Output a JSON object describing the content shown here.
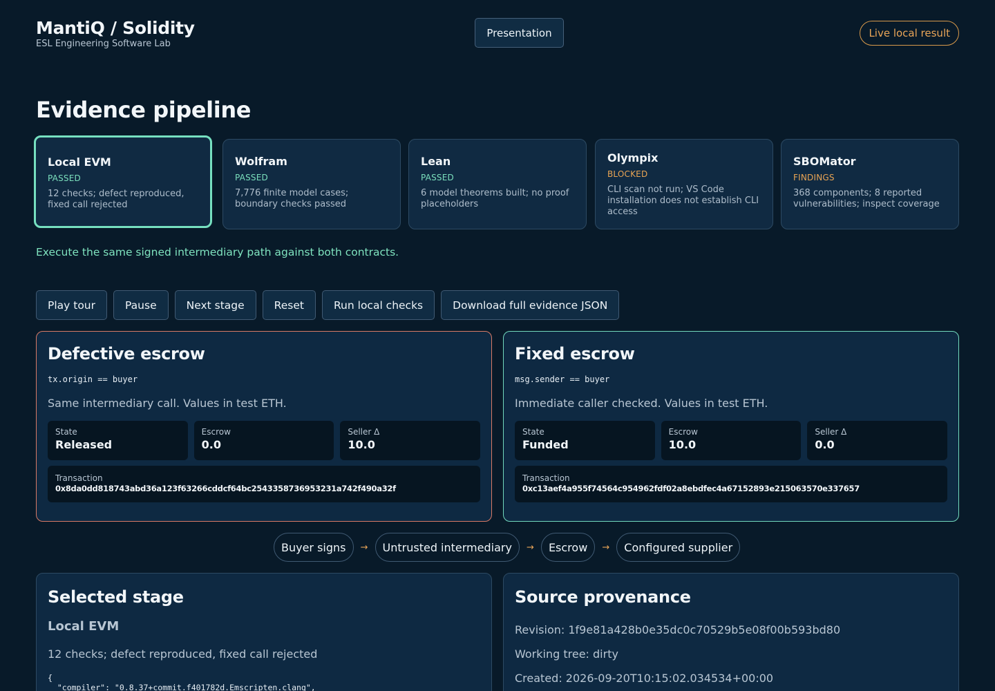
{
  "header": {
    "title": "MantiQ / Solidity",
    "subtitle": "ESL Engineering Software Lab",
    "presentation_label": "Presentation",
    "live_badge": "Live local result"
  },
  "pipeline": {
    "title": "Evidence pipeline",
    "stages": [
      {
        "name": "Local EVM",
        "status": "PASSED",
        "description": "12 checks; defect reproduced, fixed call rejected",
        "status_color": "#7be0bd"
      },
      {
        "name": "Wolfram",
        "status": "PASSED",
        "description": "7,776 finite model cases; boundary checks passed",
        "status_color": "#7be0bd"
      },
      {
        "name": "Lean",
        "status": "PASSED",
        "description": "6 model theorems built; no proof placeholders",
        "status_color": "#7be0bd"
      },
      {
        "name": "Olympix",
        "status": "BLOCKED",
        "description": "CLI scan not run; VS Code installation does not establish CLI access",
        "status_color": "#eaa554"
      },
      {
        "name": "SBOMator",
        "status": "FINDINGS",
        "description": "368 components; 8 reported vulnerabilities; inspect coverage",
        "status_color": "#eaa554"
      }
    ],
    "tip": "Execute the same signed intermediary path against both contracts."
  },
  "controls": {
    "play": "Play tour",
    "pause": "Pause",
    "next": "Next stage",
    "reset": "Reset",
    "run": "Run local checks",
    "download": "Download full evidence JSON"
  },
  "defective": {
    "title": "Defective escrow",
    "code": "tx.origin == buyer",
    "note": "Same intermediary call. Values in test ETH.",
    "state_label": "State",
    "state": "Released",
    "escrow_label": "Escrow",
    "escrow": "0.0",
    "seller_label": "Seller Δ",
    "seller": "10.0",
    "tx_label": "Transaction",
    "tx": "0x8da0dd818743abd36a123f63266cddcf64bc2543358736953231a742f490a32f"
  },
  "fixed": {
    "title": "Fixed escrow",
    "code": "msg.sender == buyer",
    "note": "Immediate caller checked. Values in test ETH.",
    "state_label": "State",
    "state": "Funded",
    "escrow_label": "Escrow",
    "escrow": "10.0",
    "seller_label": "Seller Δ",
    "seller": "0.0",
    "tx_label": "Transaction",
    "tx": "0xc13aef4a955f74564c954962fdf02a8ebdfec4a67152893e215063570e337657"
  },
  "flow": {
    "nodes": [
      "Buyer signs",
      "Untrusted intermediary",
      "Escrow",
      "Configured supplier"
    ],
    "arrow": "→"
  },
  "selected": {
    "title": "Selected stage",
    "stage": "Local EVM",
    "description": "12 checks; defect reproduced, fixed call rejected",
    "json_preview": "{\n  \"compiler\": \"0.8.37+commit.f401782d.Emscripten.clang\","
  },
  "provenance": {
    "title": "Source provenance",
    "revision": "Revision: 1f9e81a428b0e35dc0c70529b5e08f00b593bd80",
    "working_tree": "Working tree: dirty",
    "created": "Created: 2026-09-20T10:15:02.034534+00:00"
  }
}
